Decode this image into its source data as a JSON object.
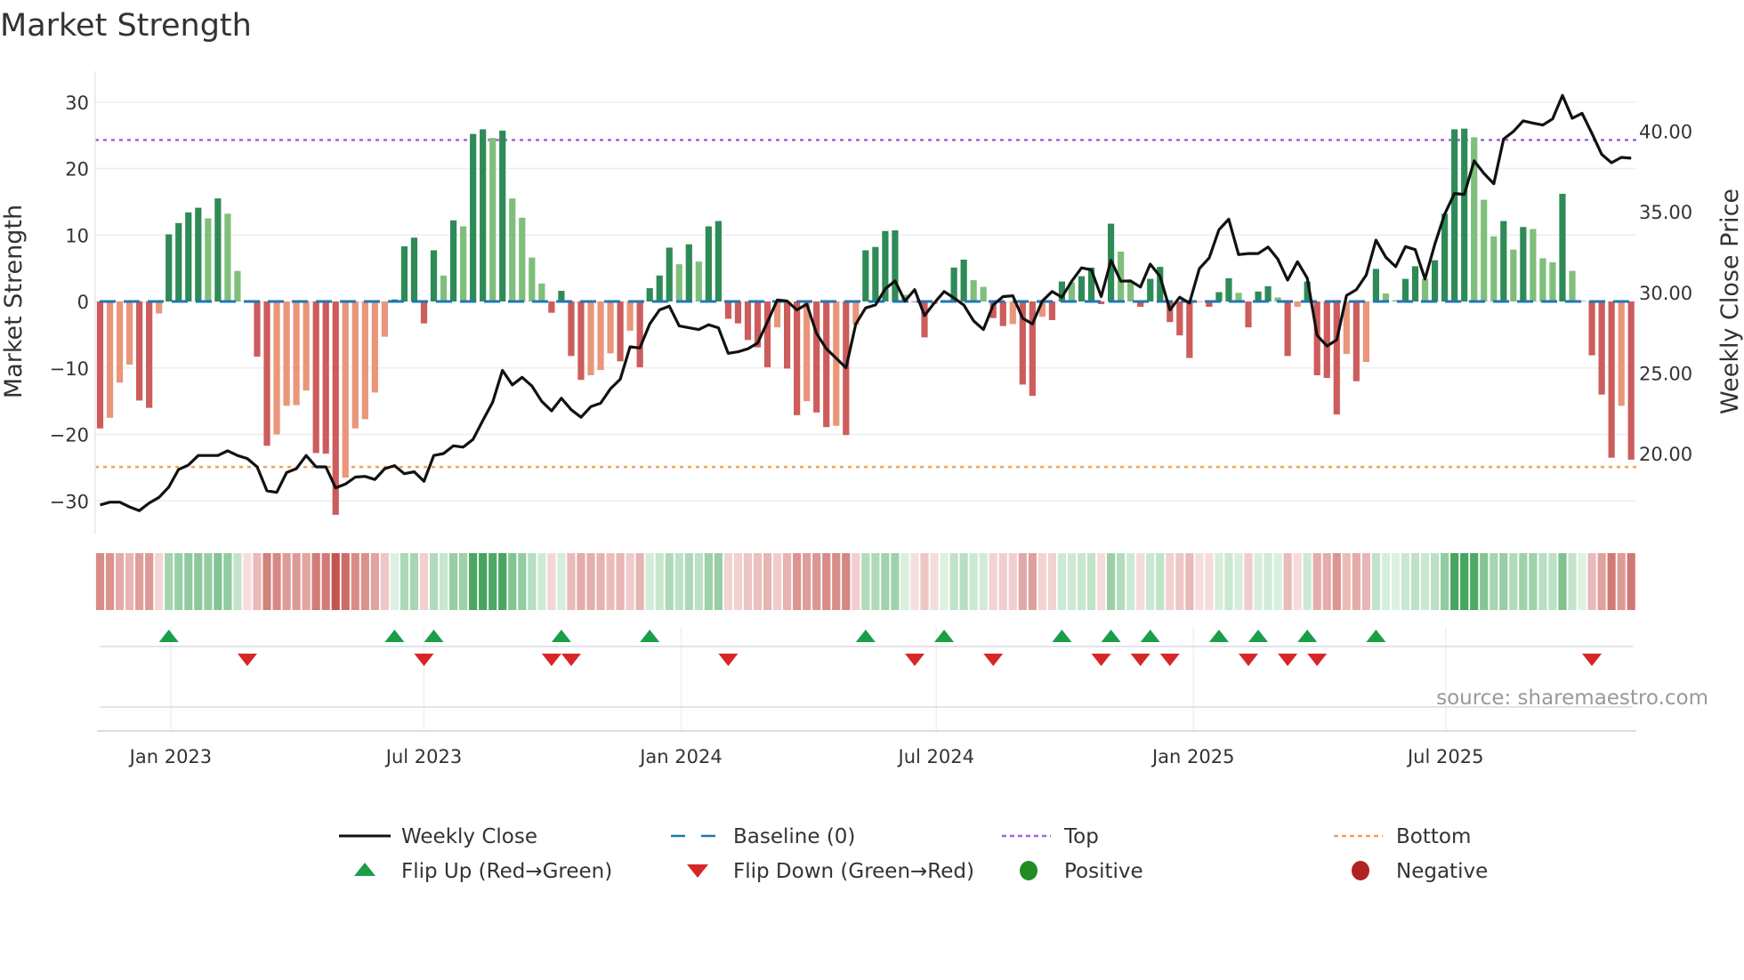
{
  "title": "Market Strength",
  "source": "source: sharemaestro.com",
  "colors": {
    "pos_dark": "#2e8b57",
    "pos_light": "#7fbf7b",
    "neg_dark": "#cd5c5c",
    "neg_light": "#e9967a",
    "baseline": "#1f77b4",
    "top": "#a066dc",
    "bottom": "#f0a25e",
    "flip_up": "#1a9e48",
    "flip_down": "#d62728",
    "positive": "#228b22",
    "negative": "#b22222",
    "close": "#111111"
  },
  "chart_data": {
    "type": "bar+line",
    "title": "Market Strength",
    "ylabel": "Market Strength",
    "y2label": "Weekly Close Price",
    "ylim": [
      -35,
      35
    ],
    "y2lim": [
      14.8,
      44.3
    ],
    "grid": true,
    "legend_position": "bottom",
    "top_level": 24.3,
    "bottom_level": -24.9,
    "baseline": 0,
    "y_ticks": [
      {
        "value": 30,
        "label": "30"
      },
      {
        "value": 20,
        "label": "20"
      },
      {
        "value": 10,
        "label": "10"
      },
      {
        "value": 0,
        "label": "0"
      },
      {
        "value": -10,
        "label": "−10"
      },
      {
        "value": -20,
        "label": "−20"
      },
      {
        "value": -30,
        "label": "−30"
      }
    ],
    "y2_ticks": [
      {
        "value": 40,
        "label": "40.00"
      },
      {
        "value": 35,
        "label": "35.00"
      },
      {
        "value": 30,
        "label": "30.00"
      },
      {
        "value": 25,
        "label": "25.00"
      },
      {
        "value": 20,
        "label": "20.00"
      }
    ],
    "x_ticks": [
      {
        "week": 8.2,
        "label": "Jan 2023"
      },
      {
        "week": 34.0,
        "label": "Jul 2023"
      },
      {
        "week": 60.2,
        "label": "Jan 2024"
      },
      {
        "week": 86.2,
        "label": "Jul 2024"
      },
      {
        "week": 112.4,
        "label": "Jan 2025"
      },
      {
        "week": 138.1,
        "label": "Jul 2025"
      }
    ],
    "strength": [
      -19.1,
      -17.5,
      -12.2,
      -9.5,
      -14.9,
      -16,
      -1.8,
      10.1,
      11.8,
      13.4,
      14.1,
      12.5,
      15.5,
      13.2,
      4.6,
      -0.2,
      -8.3,
      -21.7,
      -20,
      -15.7,
      -15.6,
      -13.4,
      -22.8,
      -22.9,
      -32.1,
      -26.5,
      -19.1,
      -17.7,
      -13.7,
      -5.3,
      0.3,
      8.3,
      9.6,
      -3.3,
      7.7,
      3.9,
      12.2,
      11.3,
      25.2,
      25.9,
      24.6,
      25.7,
      15.5,
      12.6,
      6.6,
      2.7,
      -1.7,
      1.6,
      -8.2,
      -11.8,
      -11.1,
      -10.3,
      -7.8,
      -9.0,
      -4.4,
      -9.9,
      2.0,
      3.9,
      8.1,
      5.6,
      8.6,
      6.0,
      11.3,
      12.1,
      -2.6,
      -3.3,
      -5.8,
      -6.9,
      -9.9,
      -3.9,
      -10.1,
      -17.1,
      -15.0,
      -16.7,
      -18.9,
      -18.7,
      -20.1,
      -3.5,
      7.7,
      8.2,
      10.6,
      10.7,
      1.0,
      -0.1,
      -5.4,
      -0.4,
      0.2,
      5.1,
      6.3,
      3.2,
      2.2,
      -2.5,
      -3.7,
      -3.4,
      -12.5,
      -14.2,
      -2.3,
      -2.8,
      3.0,
      2.9,
      3.8,
      5.1,
      -0.4,
      11.7,
      7.5,
      2.9,
      -0.8,
      3.4,
      5.2,
      -3.1,
      -5.1,
      -8.5,
      -0.1,
      -0.8,
      1.4,
      3.5,
      1.3,
      -3.9,
      1.5,
      2.3,
      0.6,
      -8.2,
      -0.8,
      3.0,
      -11.1,
      -11.5,
      -17.0,
      -7.9,
      -12.0,
      -9.1,
      4.9,
      1.2,
      0.2,
      3.4,
      5.3,
      3.4,
      6.2,
      13.2,
      25.9,
      26.0,
      24.7,
      15.3,
      9.8,
      12.1,
      7.8,
      11.2,
      10.9,
      6.5,
      5.9,
      16.2,
      4.6,
      0.1,
      -8.1,
      -14.0,
      -23.5,
      -15.7,
      -23.8
    ],
    "close": [
      16.81,
      16.98,
      16.98,
      16.69,
      16.46,
      16.93,
      17.28,
      17.92,
      19.01,
      19.29,
      19.88,
      19.88,
      19.88,
      20.17,
      19.88,
      19.69,
      19.17,
      17.69,
      17.59,
      18.82,
      19.06,
      19.88,
      19.17,
      19.17,
      17.87,
      18.11,
      18.54,
      18.58,
      18.39,
      19.06,
      19.25,
      18.75,
      18.87,
      18.28,
      19.88,
      20.0,
      20.48,
      20.4,
      20.88,
      22.06,
      23.19,
      25.16,
      24.26,
      24.73,
      24.19,
      23.24,
      22.65,
      23.43,
      22.72,
      22.25,
      22.91,
      23.12,
      24.02,
      24.61,
      26.62,
      26.55,
      28.04,
      28.91,
      29.15,
      27.92,
      27.8,
      27.69,
      27.99,
      27.8,
      26.22,
      26.31,
      26.5,
      26.86,
      28.16,
      29.53,
      29.46,
      28.91,
      29.27,
      27.45,
      26.5,
      25.91,
      25.32,
      28.04,
      29.03,
      29.22,
      30.21,
      30.71,
      29.46,
      30.17,
      28.56,
      29.34,
      30.05,
      29.65,
      29.22,
      28.23,
      27.69,
      29.22,
      29.74,
      29.79,
      28.39,
      28.04,
      29.46,
      30.05,
      29.7,
      30.69,
      31.52,
      31.4,
      29.74,
      31.99,
      30.69,
      30.71,
      30.33,
      31.75,
      30.99,
      28.91,
      29.7,
      29.34,
      31.47,
      32.13,
      33.88,
      34.54,
      32.34,
      32.41,
      32.41,
      32.81,
      32.06,
      30.76,
      31.9,
      30.88,
      27.33,
      26.67,
      27.05,
      29.81,
      30.17,
      31.07,
      33.24,
      32.18,
      31.59,
      32.84,
      32.65,
      30.83,
      33.0,
      34.85,
      36.13,
      36.08,
      38.16,
      37.38,
      36.74,
      39.51,
      39.98,
      40.64,
      40.5,
      40.38,
      40.76,
      42.22,
      40.8,
      41.11,
      39.86,
      38.56,
      38.04,
      38.37,
      38.32
    ],
    "legend": [
      {
        "label": "Weekly Close"
      },
      {
        "label": "Baseline (0)"
      },
      {
        "label": "Top"
      },
      {
        "label": "Bottom"
      },
      {
        "label": "Flip Up (Red→Green)"
      },
      {
        "label": "Flip Down (Green→Red)"
      },
      {
        "label": "Positive"
      },
      {
        "label": "Negative"
      }
    ]
  }
}
